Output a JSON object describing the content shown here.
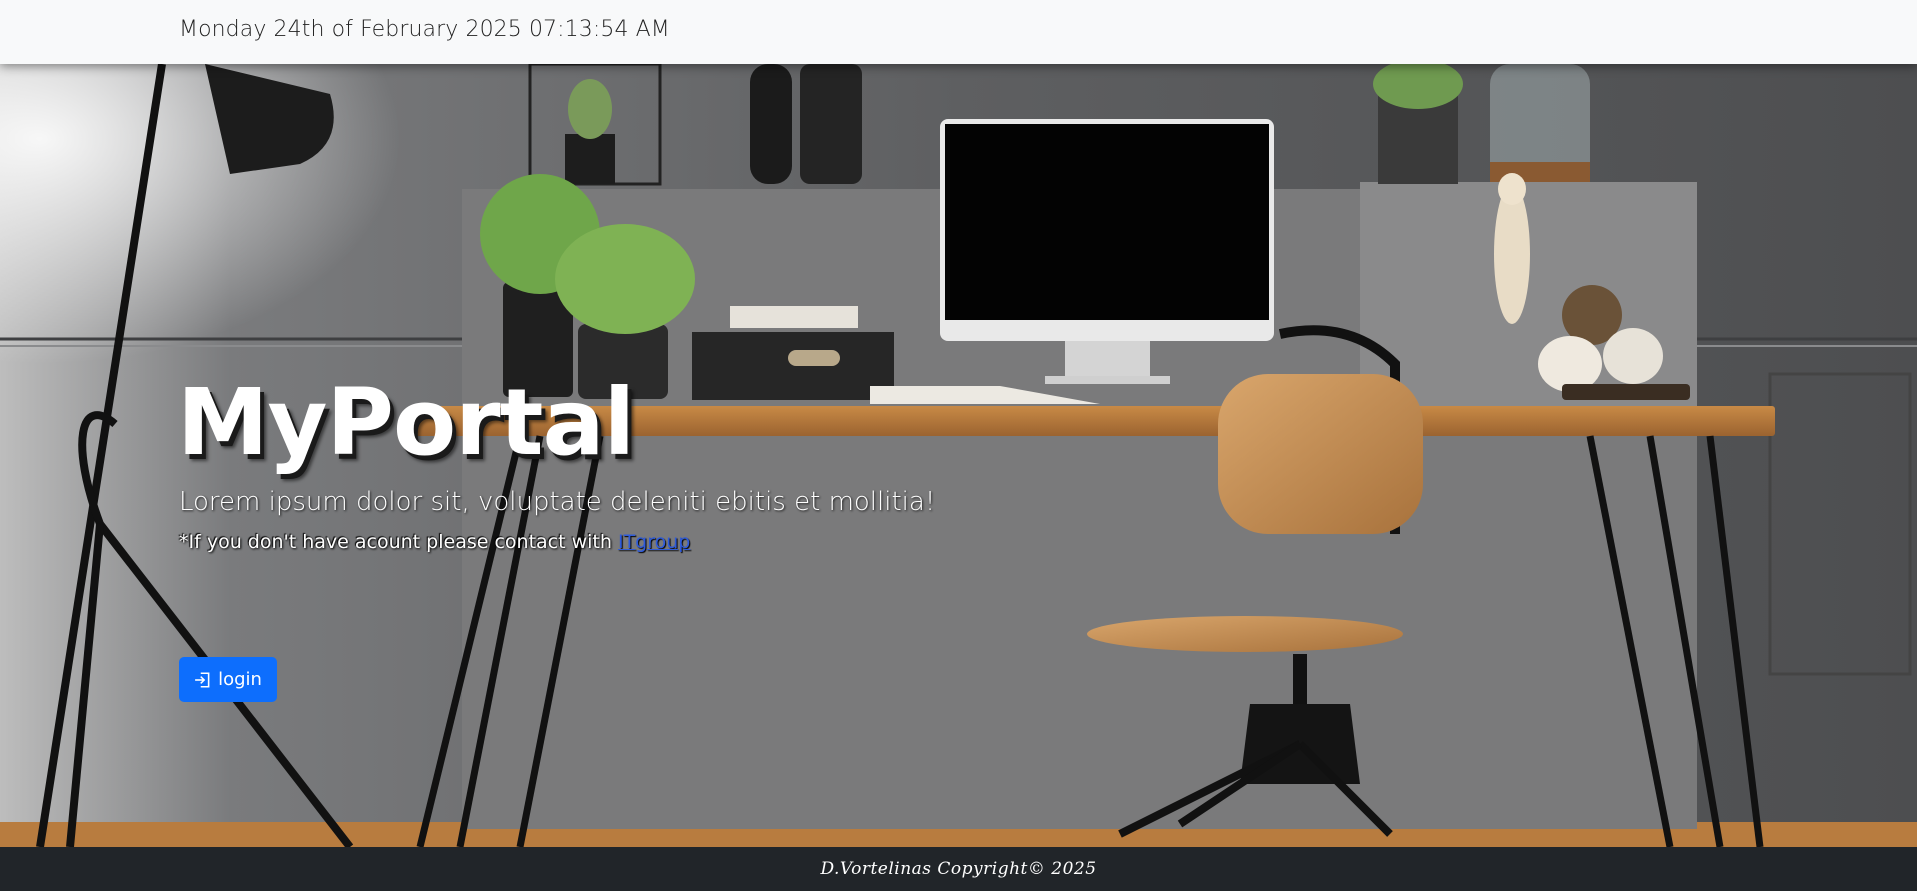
{
  "header": {
    "datetime": "Monday 24th of February 2025 07:13:54 AM"
  },
  "hero": {
    "title": "MyPortal",
    "lead": "Lorem ipsum dolor sit, voluptate deleniti ebitis et mollitia!",
    "note_prefix": "*If you don't have acount please contact with ",
    "note_link": "ITgroup",
    "login_label": "login",
    "login_icon": "box-arrow-in-right-icon"
  },
  "footer": {
    "copyright": "D.Vortelinas Copyright© 2025"
  },
  "colors": {
    "primary": "#0d6efd",
    "topbar": "#f8f9fa",
    "footer": "#212529",
    "link": "#2f5bd8"
  }
}
